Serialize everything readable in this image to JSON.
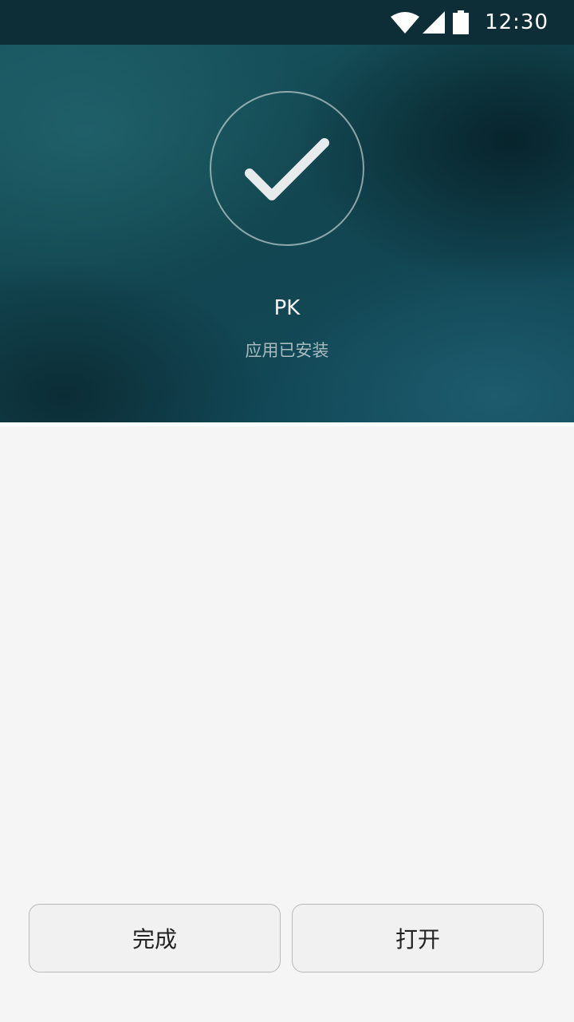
{
  "status_bar": {
    "time": "12:30",
    "icons": [
      "wifi-icon",
      "signal-icon",
      "battery-icon"
    ]
  },
  "install_result": {
    "icon": "checkmark-icon",
    "app_name": "PK",
    "status_text": "应用已安装"
  },
  "actions": {
    "done_label": "完成",
    "open_label": "打开"
  },
  "colors": {
    "status_bar_bg": "#0d2e37",
    "hero_teal": "#124650",
    "page_bg": "#f5f5f5",
    "button_bg": "#f1f1f1"
  }
}
